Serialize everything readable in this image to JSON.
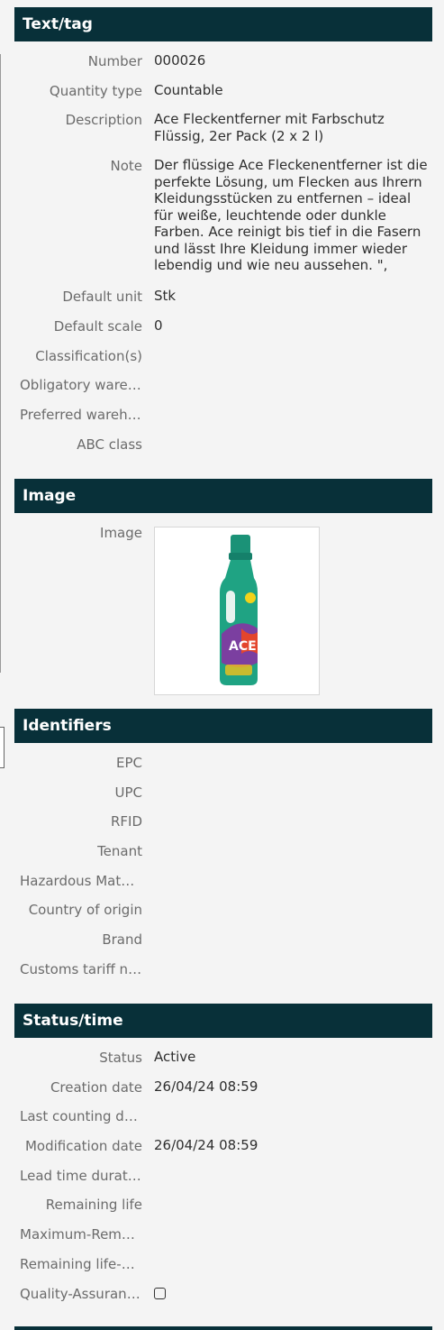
{
  "sections": {
    "text_tag": {
      "title": "Text/tag",
      "number_label": "Number",
      "number_value": "000026",
      "qty_label": "Quantity type",
      "qty_value": "Countable",
      "desc_label": "Description",
      "desc_value": "Ace Fleckentferner mit Farbschutz Flüssig, 2er Pack (2 x 2 l)",
      "note_label": "Note",
      "note_value": "Der flüssige Ace Fleckenentferner ist die perfekte Lösung, um Flecken aus Ihrern Kleidungsstücken zu entfernen – ideal für weiße, leuchtende oder dunkle Farben. Ace reinigt bis tief in die Fasern und lässt Ihre Kleidung immer wieder lebendig und wie neu aussehen. \",",
      "unit_label": "Default unit",
      "unit_value": "Stk",
      "scale_label": "Default scale",
      "scale_value": "0",
      "class_label": "Classification(s)",
      "oblig_label": "Obligatory warehouse",
      "pref_label": "Preferred warehouse",
      "abc_label": "ABC class"
    },
    "image": {
      "title": "Image",
      "image_label": "Image",
      "bottle_brand": "ACE"
    },
    "identifiers": {
      "title": "Identifiers",
      "labels": [
        "EPC",
        "UPC",
        "RFID",
        "Tenant",
        "Hazardous Materials",
        "Country of origin",
        "Brand",
        "Customs tariff number"
      ]
    },
    "status_time": {
      "title": "Status/time",
      "status_label": "Status",
      "status_value": "Active",
      "creation_label": "Creation date",
      "creation_value": "26/04/24 08:59",
      "lastcount_label": "Last counting date",
      "mod_label": "Modification date",
      "mod_value": "26/04/24 08:59",
      "lead_label": "Lead time duration",
      "remain_label": "Remaining life",
      "maxrem_label": "Maximum-Remaining life",
      "remlife_label": "Remaining life-unit",
      "qa_label": "Quality-Assurance",
      "qa_checked": false
    }
  },
  "colors": {
    "header_bg": "#083039",
    "page_bg": "#f4f4f4",
    "bottle_green": "#1fa383"
  }
}
